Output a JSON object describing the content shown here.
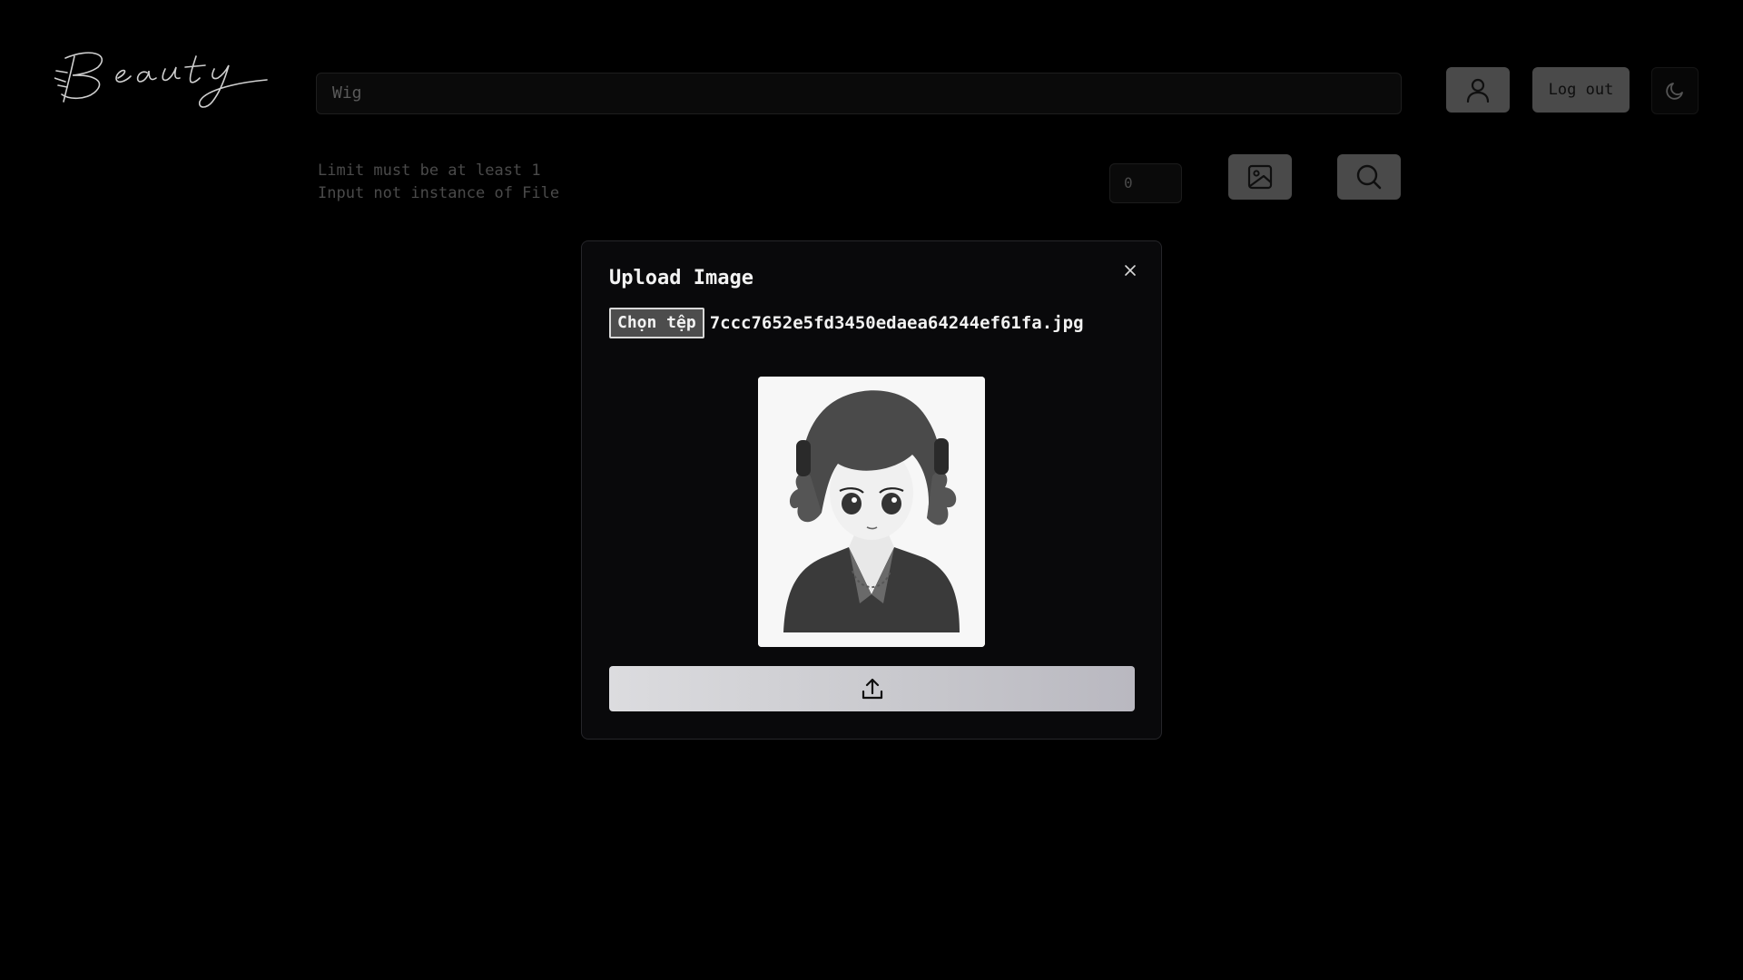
{
  "header": {
    "logo_text": "Beauty",
    "search_value": "Wig",
    "logout_label": "Log out",
    "user_icon": "user-icon",
    "theme_icon": "moon-icon"
  },
  "toolbar": {
    "errors": [
      "Limit must be at least 1",
      "Input not instance of File"
    ],
    "limit_value": "0",
    "image_icon": "image-icon",
    "search_icon": "search-icon"
  },
  "modal": {
    "title": "Upload Image",
    "choose_file_label": "Chọn tệp",
    "file_name": "7ccc7652e5fd3450edaea64244ef61fa.jpg",
    "close_icon": "close-icon",
    "upload_icon": "upload-icon"
  }
}
